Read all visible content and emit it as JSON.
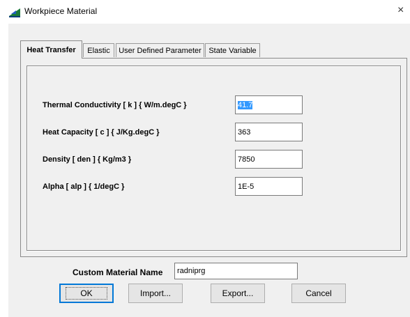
{
  "window": {
    "title": "Workpiece Material",
    "close_glyph": "×"
  },
  "tabs": [
    {
      "label": "Heat Transfer",
      "active": true
    },
    {
      "label": "Elastic",
      "active": false
    },
    {
      "label": "User Defined Parameter",
      "active": false
    },
    {
      "label": "State Variable",
      "active": false
    }
  ],
  "properties": [
    {
      "label": "Thermal Conductivity  [ k ]  { W/m.degC }",
      "value": "41.7",
      "selected": true
    },
    {
      "label": "Heat Capacity  [ c ]  { J/Kg.degC }",
      "value": "363",
      "selected": false
    },
    {
      "label": "Density [ den ]  { Kg/m3 }",
      "value": "7850",
      "selected": false
    },
    {
      "label": "Alpha [ alp ]  { 1/degC }",
      "value": "1E-5",
      "selected": false
    }
  ],
  "custom_material": {
    "label": "Custom Material Name",
    "value": "radniprg"
  },
  "buttons": {
    "ok": "OK",
    "import": "Import...",
    "export": "Export...",
    "cancel": "Cancel"
  }
}
